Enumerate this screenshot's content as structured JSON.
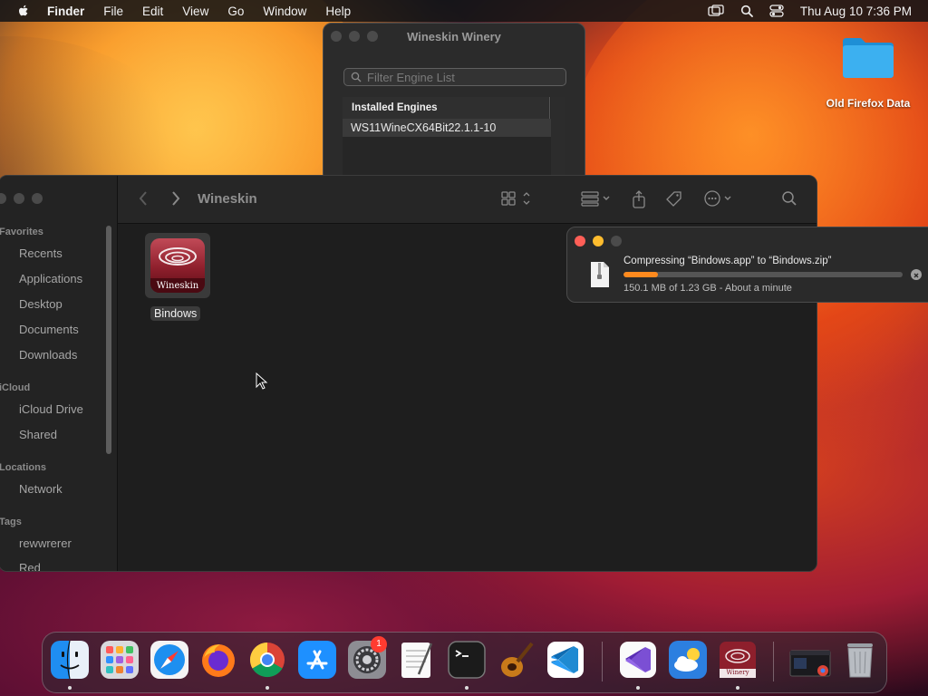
{
  "menubar": {
    "app": "Finder",
    "menus": [
      "File",
      "Edit",
      "View",
      "Go",
      "Window",
      "Help"
    ],
    "clock": "Thu Aug 10  7:36 PM"
  },
  "desktop": {
    "folder_label": "Old Firefox Data"
  },
  "winery": {
    "title": "Wineskin Winery",
    "search_placeholder": "Filter Engine List",
    "list_header": "Installed Engines",
    "engines": [
      "WS11WineCX64Bit22.1.1-10"
    ]
  },
  "finder": {
    "title": "Wineskin",
    "sidebar": {
      "favorites_header": "Favorites",
      "favorites": [
        "Recents",
        "Applications",
        "Desktop",
        "Documents",
        "Downloads"
      ],
      "icloud_header": "iCloud",
      "icloud": [
        "iCloud Drive",
        "Shared"
      ],
      "locations_header": "Locations",
      "locations": [
        "Network"
      ],
      "tags_header": "Tags",
      "tags": [
        "rewwrerer",
        "Red"
      ]
    },
    "item": {
      "icon_text": "Wineskin",
      "label": "Bindows"
    }
  },
  "progress": {
    "message": "Compressing “Bindows.app” to “Bindows.zip”",
    "detail": "150.1 MB of 1.23 GB - About a minute",
    "fraction": 0.122,
    "bar_color": "#ff8a1e"
  },
  "dock": {
    "apps": [
      "Finder",
      "Launchpad",
      "Safari",
      "Firefox",
      "Chrome",
      "App Store",
      "System Settings",
      "TextEdit",
      "Terminal",
      "GarageBand",
      "Visual Studio Code",
      "Visual Studio",
      "Weather",
      "Winery",
      "Window Preview",
      "Trash"
    ],
    "system_settings_badge": "1",
    "winery_label": "Winery"
  }
}
